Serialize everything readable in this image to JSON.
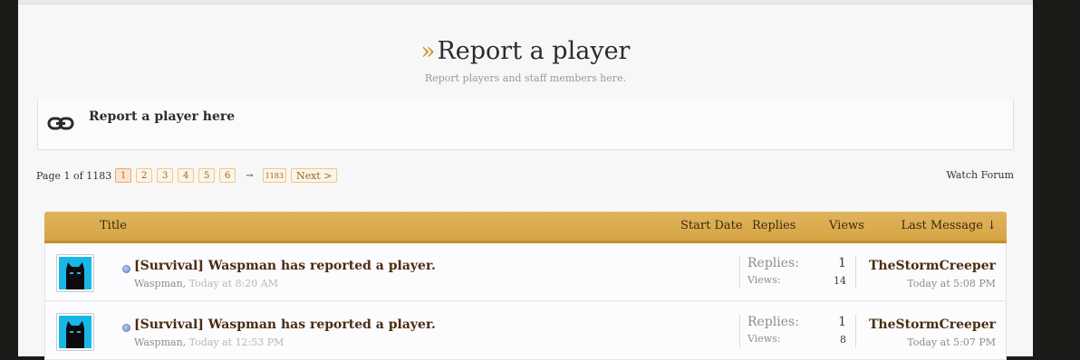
{
  "forum": {
    "title": "Report a player",
    "title_marker": "»",
    "subtitle": "Report players and staff members here.",
    "link_label": "Report a player here",
    "link_icon": "link-icon"
  },
  "pagination": {
    "info": "Page 1 of 1183",
    "pages": [
      "1",
      "2",
      "3",
      "4",
      "5",
      "6"
    ],
    "current_page": "1",
    "jump_arrow": "→",
    "last_page": "1183",
    "next_label": "Next >"
  },
  "watch_forum_label": "Watch Forum",
  "table": {
    "headers": {
      "title": "Title",
      "start_date": "Start Date",
      "replies": "Replies",
      "views": "Views",
      "last_message": "Last Message ↓"
    },
    "rows": [
      {
        "title": "[Survival] Waspman has reported a player.",
        "author": "Waspman,",
        "date": "Today at 8:20 AM",
        "replies_label": "Replies:",
        "replies": "1",
        "views_label": "Views:",
        "views": "14",
        "last_user": "TheStormCreeper",
        "last_date": "Today at 5:08 PM"
      },
      {
        "title": "[Survival] Waspman has reported a player.",
        "author": "Waspman,",
        "date": "Today at 12:53 PM",
        "replies_label": "Replies:",
        "replies": "1",
        "views_label": "Views:",
        "views": "8",
        "last_user": "TheStormCreeper",
        "last_date": "Today at 5:07 PM"
      }
    ]
  },
  "colors": {
    "header_gold": "#d6a444",
    "title_brown": "#4a2d12",
    "avatar_blue": "#17b8e6"
  }
}
